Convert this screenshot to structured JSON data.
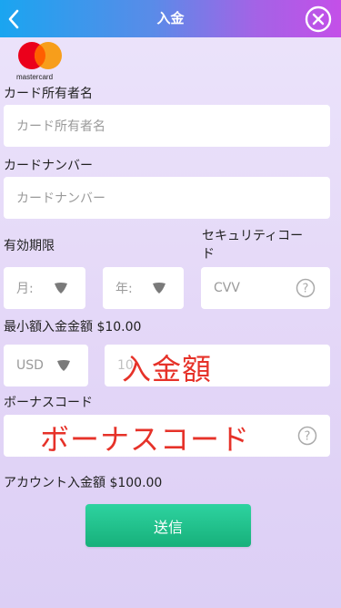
{
  "header": {
    "title": "入金"
  },
  "logo": {
    "text": "mastercard"
  },
  "form": {
    "holder": {
      "label": "カード所有者名",
      "placeholder": "カード所有者名"
    },
    "number": {
      "label": "カードナンバー",
      "placeholder": "カードナンバー"
    },
    "expiry": {
      "label": "有効期限",
      "month_placeholder": "月:",
      "year_placeholder": "年:"
    },
    "security": {
      "label_line1": "セキュリティコー",
      "label_line2": "ド",
      "placeholder": "CVV"
    },
    "min_amount": {
      "label": "最小額入金金額 $10.00"
    },
    "currency": {
      "value": "USD"
    },
    "amount": {
      "placeholder_partial": "10",
      "overlay_text": "入金額"
    },
    "bonus": {
      "label": "ボーナスコード",
      "overlay_text": "ボーナスコード"
    },
    "account_amount": {
      "label": "アカウント入金額 $100.00"
    },
    "submit_label": "送信"
  },
  "colors": {
    "header_start": "#1aa5f0",
    "header_end": "#c44fe8",
    "overlay_red": "#e63229",
    "submit_green": "#1fbf88"
  },
  "icons": [
    "back-chevron-icon",
    "close-circle-x-icon",
    "mastercard-logo",
    "dropdown-arrow-icon",
    "help-question-icon"
  ]
}
